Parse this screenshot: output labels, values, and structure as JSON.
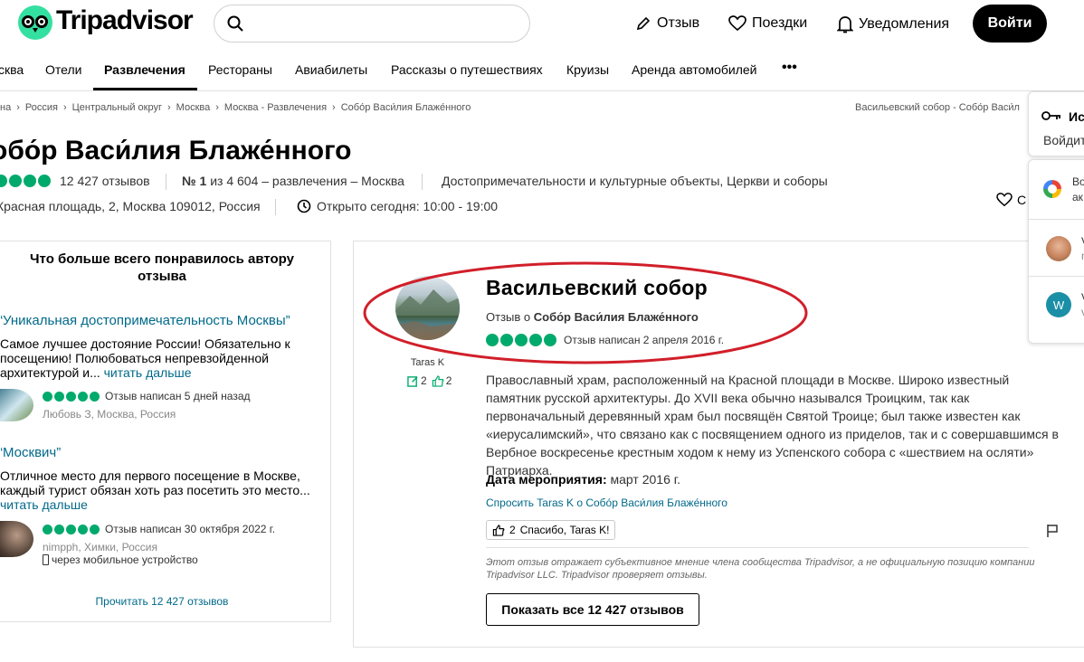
{
  "header": {
    "logo_text": "Tripadvisor",
    "search_placeholder": "",
    "review_label": "Отзыв",
    "trips_label": "Поездки",
    "notifications_label": "Уведомления",
    "login_label": "Войти"
  },
  "nav": {
    "items": [
      "сква",
      "Отели",
      "Развлечения",
      "Рестораны",
      "Авиабилеты",
      "Рассказы о путешествиях",
      "Круизы",
      "Аренда автомобилей"
    ],
    "more": "•••"
  },
  "breadcrumb": {
    "items": [
      "на",
      "Россия",
      "Центральный округ",
      "Москва",
      "Москва - Развлечения",
      "Собо́р Васи́лия Блаже́нного"
    ],
    "right": "Васильевский собор - Собо́р Васи́л"
  },
  "attraction": {
    "title": "обо́р Васи́лия Блаже́нного",
    "reviews_count": "12 427 отзывов",
    "rank_bold": "№ 1",
    "rank_rest": "из 4 604 – развлечения – Москва",
    "categories": "Достопримечательности и культурные объекты, Церкви и соборы",
    "address": "Красная площадь, 2, Москва 109012, Россия",
    "hours": "Открыто сегодня: 10:00 - 19:00",
    "save_label": "С"
  },
  "left_panel": {
    "title": "Что больше всего понравилось автору отзыва",
    "reviews": [
      {
        "quote": "“Уникальная достопримечательность Москвы”",
        "text": "Самое лучшее достояние России! Обязательно к посещению! Полюбоваться непревзойденной архитектурой и...",
        "read_more": "читать дальше",
        "date": "Отзыв написан 5 дней назад",
        "author": "Любовь З, Москва, Россия"
      },
      {
        "quote": "“Москвич”",
        "text": "Отличное место для первого посещение в Москве, каждый турист обязан хоть раз посетить это место...",
        "read_more": "читать дальше",
        "date": "Отзыв написан 30 октября 2022 г.",
        "author": "nimpph, Химки, Россия",
        "device": "через мобильное устройство"
      }
    ],
    "read_all": "Прочитать 12 427 отзывов"
  },
  "review": {
    "reviewer_name": "Taras K",
    "contrib_count": "2",
    "helpful_count": "2",
    "title": "Васильевский собор",
    "about_prefix": "Отзыв о",
    "about_place": "Собо́р Васи́лия Блаже́нного",
    "date": "Отзыв написан 2 апреля 2016 г.",
    "rating": 5,
    "text": "Православный храм, расположенный на Красной площади в Москве. Широко известный памятник русской архитектуры. До XVII века обычно назывался Троицким, так как первоначальный деревянный храм был посвящён Святой Троице; был также известен как «иерусалимский», что связано как с посвящением одного из приделов, так и с совершавшимся в Вербное воскресенье крестным ходом к нему из Успенского собора с «шествием на осляти» Патриарха.",
    "event_date_label": "Дата мероприятия:",
    "event_date_value": "март 2016 г.",
    "ask_link": "Спросить Taras K о Собо́р Васи́лия Блаже́нного",
    "thanks_count": "2",
    "thanks_label": "Спасибо, Taras K!",
    "disclaimer": "Этот отзыв отражает субъективное мнение члена сообщества Tripadvisor, а не официальную позицию компании Tripadvisor LLC. Tripadvisor проверяет отзывы.",
    "show_all": "Показать все 12 427 отзывов"
  },
  "side_popup": {
    "title": "Ис",
    "subtitle": "Войдит",
    "google_line1": "Во",
    "google_line2": "ак",
    "user1_letter": "V",
    "user1_sub": "n",
    "user2_initial": "W",
    "user2_letter": "V",
    "user2_sub": "v"
  },
  "colors": {
    "accent_green": "#00aa6c",
    "link_blue": "#00698a",
    "annotation_red": "#d11f2a",
    "logo_green": "#34e0a1"
  }
}
